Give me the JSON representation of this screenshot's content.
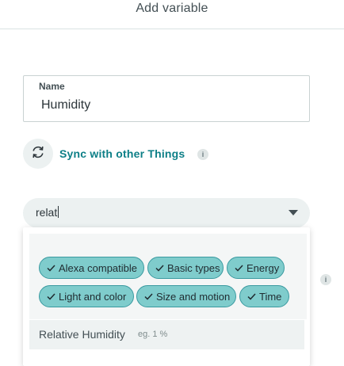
{
  "header": {
    "title": "Add variable"
  },
  "name_field": {
    "label": "Name",
    "value": "Humidity"
  },
  "sync": {
    "label": "Sync with other Things",
    "icon": "sync-icon",
    "info_icon": "info-icon",
    "info_glyph": "i"
  },
  "type_select": {
    "value": "relat",
    "icon": "chevron-down-icon"
  },
  "filters": [
    {
      "label": "Alexa compatible"
    },
    {
      "label": "Basic types"
    },
    {
      "label": "Energy"
    },
    {
      "label": "Light and color"
    },
    {
      "label": "Size and motion"
    },
    {
      "label": "Time"
    }
  ],
  "suggestions": [
    {
      "label": "Relative Humidity",
      "hint": "eg. 1 %"
    }
  ],
  "side_info": {
    "glyph": "i"
  },
  "colors": {
    "accent": "#0d7f87",
    "chip_fill": "#7fcccc",
    "chip_border": "#3a9aa0",
    "field_bg": "#ecf1f1"
  }
}
